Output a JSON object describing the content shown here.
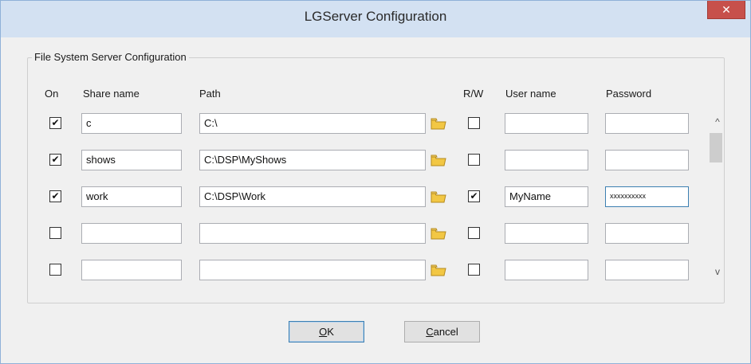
{
  "window": {
    "title": "LGServer Configuration",
    "close_glyph": "✕"
  },
  "group": {
    "legend": "File System Server Configuration"
  },
  "headers": {
    "on": "On",
    "share": "Share name",
    "path": "Path",
    "rw": "R/W",
    "user": "User name",
    "password": "Password"
  },
  "rows": [
    {
      "on": "✔",
      "share": "c",
      "path": "C:\\",
      "rw": "",
      "user": "",
      "password": ""
    },
    {
      "on": "✔",
      "share": "shows",
      "path": "C:\\DSP\\MyShows",
      "rw": "",
      "user": "",
      "password": ""
    },
    {
      "on": "✔",
      "share": "work",
      "path": "C:\\DSP\\Work",
      "rw": "✔",
      "user": "MyName",
      "password": "xxxxxxxxxx"
    },
    {
      "on": "",
      "share": "",
      "path": "",
      "rw": "",
      "user": "",
      "password": ""
    },
    {
      "on": "",
      "share": "",
      "path": "",
      "rw": "",
      "user": "",
      "password": ""
    }
  ],
  "scrollbar": {
    "up_glyph": "^",
    "down_glyph": "v"
  },
  "buttons": {
    "ok": {
      "underlined": "O",
      "rest": "K"
    },
    "cancel": {
      "underlined": "C",
      "rest": "ancel"
    }
  },
  "icons": {
    "folder": "folder-browse-icon",
    "folder_color": "#f2c744"
  }
}
